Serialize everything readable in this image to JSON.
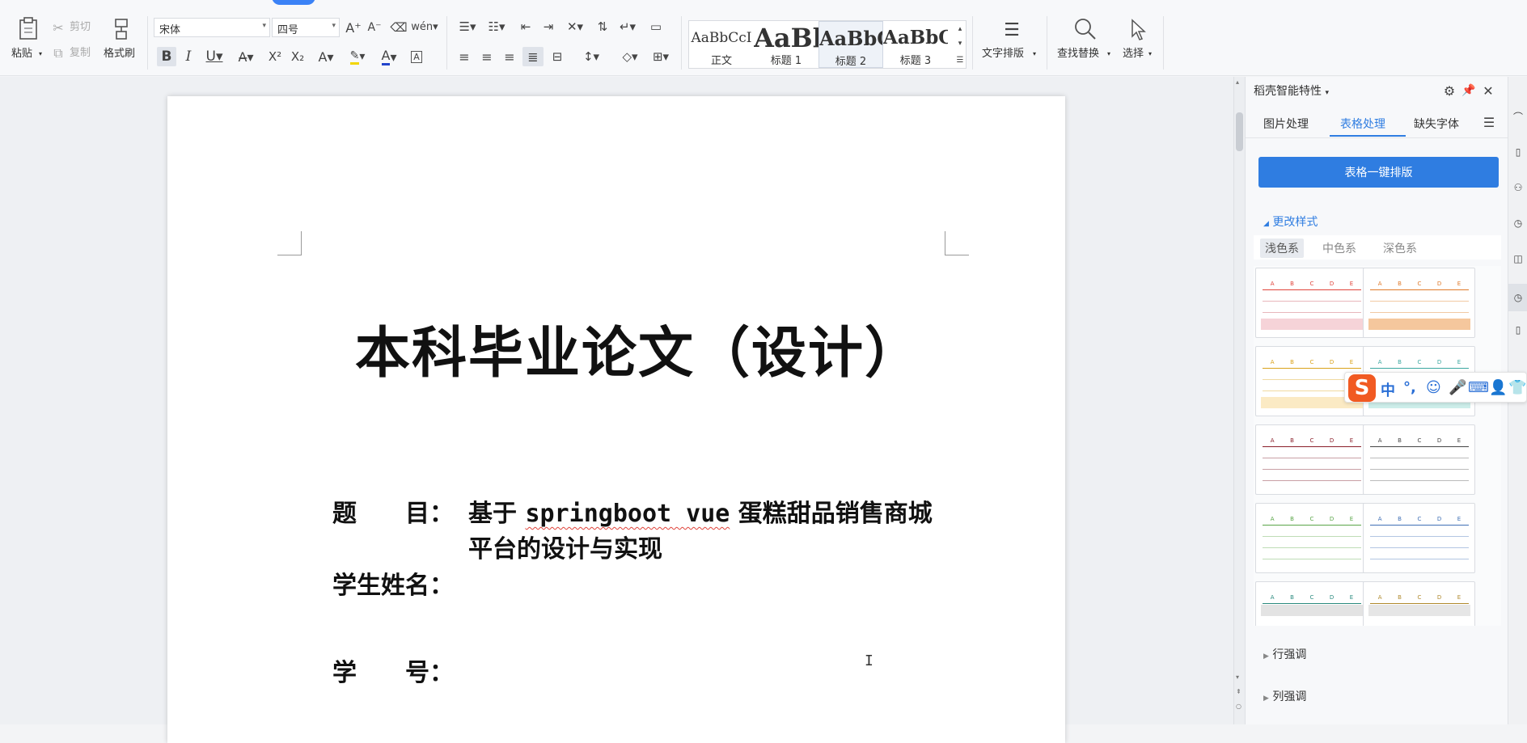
{
  "toolbar": {
    "paste": "粘贴",
    "cut": "剪切",
    "copy": "复制",
    "format_painter": "格式刷",
    "font_name": "宋体",
    "font_size": "四号",
    "styles": [
      {
        "preview": "AaBbCcI",
        "name": "正文"
      },
      {
        "preview": "AaBl",
        "name": "标题 1"
      },
      {
        "preview": "AaBbC",
        "name": "标题 2"
      },
      {
        "preview": "AaBbC",
        "name": "标题 3"
      }
    ],
    "text_layout": "文字排版",
    "find_replace": "查找替换",
    "select": "选择"
  },
  "document": {
    "title": "本科毕业论文（设计）",
    "topic_label": "题　　目：",
    "topic_line1_a": "基于",
    "topic_line1_b": "springboot vue",
    "topic_line1_c": "蛋糕甜品销售商城",
    "topic_line2": "平台的设计与实现",
    "student_name_label": "学生姓名：",
    "student_id_label": "学　　号："
  },
  "panel": {
    "header": "稻壳智能特性",
    "tabs": [
      "图片处理",
      "表格处理",
      "缺失字体"
    ],
    "active_tab": 1,
    "one_click_button": "表格一键排版",
    "change_style": "更改样式",
    "color_tabs": [
      "浅色系",
      "中色系",
      "深色系"
    ],
    "active_color_tab": 0,
    "row_emphasis": "行强调",
    "col_emphasis": "列强调",
    "thumb_header_letters": [
      "A",
      "B",
      "C",
      "D",
      "E"
    ]
  },
  "ime": {
    "mode": "中"
  },
  "colors": {
    "accent_blue": "#2f7de1",
    "ime_orange": "#f15a22"
  }
}
